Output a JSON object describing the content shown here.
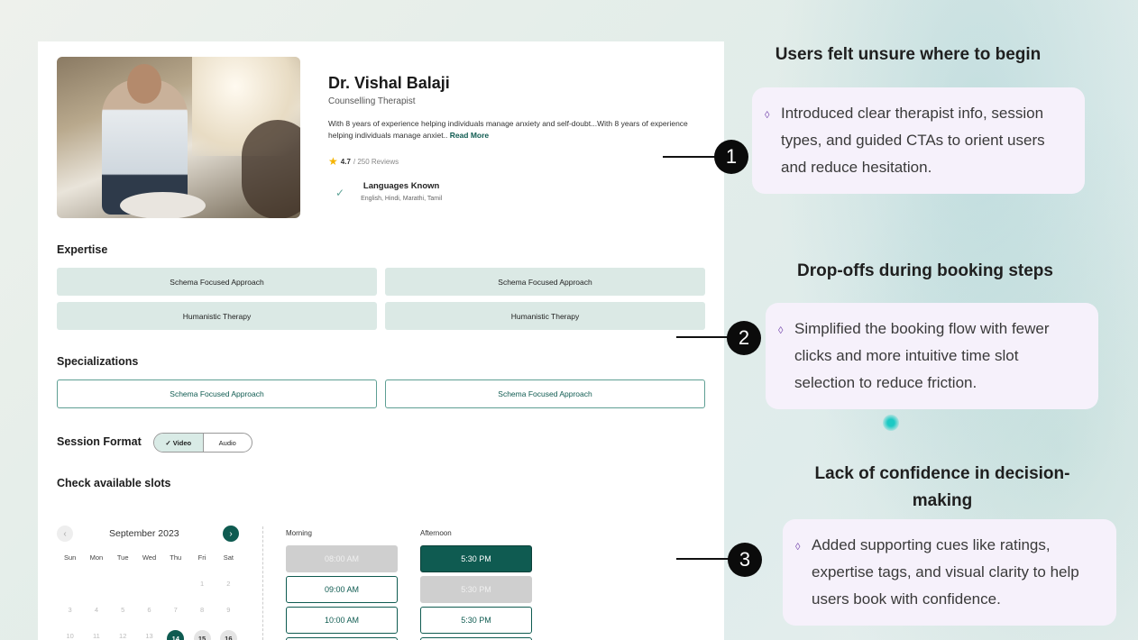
{
  "profile": {
    "name": "Dr. Vishal Balaji",
    "role": "Counselling Therapist",
    "bio": "With 8 years of experience helping individuals manage anxiety and self-doubt...With 8 years of experience helping individuals manage anxiet..",
    "read_more": "Read More",
    "rating": "4.7",
    "reviews": "/ 250 Reviews",
    "languages_title": "Languages Known",
    "languages": "English, Hindi, Marathi, Tamil"
  },
  "expertise": {
    "title": "Expertise",
    "chips": [
      "Schema Focused Approach",
      "Schema Focused Approach",
      "Humanistic Therapy",
      "Humanistic Therapy"
    ]
  },
  "specializations": {
    "title": "Specializations",
    "chips": [
      "Schema Focused Approach",
      "Schema Focused Approach"
    ]
  },
  "session": {
    "title": "Session Format",
    "options": [
      "Video",
      "Audio"
    ]
  },
  "slots": {
    "title": "Check available slots",
    "month": "September 2023",
    "weekdays": [
      "Sun",
      "Mon",
      "Tue",
      "Wed",
      "Thu",
      "Fri",
      "Sat"
    ],
    "rows": [
      [
        "",
        "",
        "",
        "",
        "",
        "1",
        "2"
      ],
      [
        "3",
        "4",
        "5",
        "6",
        "7",
        "8",
        "9"
      ],
      [
        "10",
        "11",
        "12",
        "13",
        "14",
        "15",
        "16"
      ]
    ],
    "morning_title": "Morning",
    "afternoon_title": "Afternoon",
    "morning": [
      "08:00 AM",
      "09:00 AM",
      "10:00 AM"
    ],
    "afternoon": [
      "5:30 PM",
      "5:30 PM",
      "5:30 PM"
    ]
  },
  "annotations": [
    {
      "num": "1",
      "heading": "Users felt unsure where to begin",
      "text": "Introduced clear therapist info, session types, and guided CTAs to orient users and reduce hesitation."
    },
    {
      "num": "2",
      "heading": "Drop-offs during booking steps",
      "text": "Simplified the booking flow with fewer clicks and more intuitive time slot selection to reduce friction."
    },
    {
      "num": "3",
      "heading": "Lack of confidence in decision-making",
      "text": "Added supporting cues like ratings, expertise tags, and visual clarity to help users book with confidence."
    }
  ],
  "colors": {
    "brand": "#0f5b51",
    "chip": "#dbe9e5",
    "card": "#f6f1fb"
  }
}
